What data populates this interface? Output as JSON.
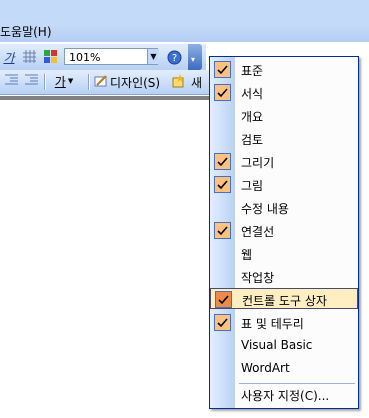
{
  "menubar": {
    "help_label": "도움말(H)"
  },
  "toolbar": {
    "zoom_value": "101%",
    "design_label": "디자인(S)",
    "new_label": "새",
    "font_char": "가",
    "underline_char": "가"
  },
  "popup": {
    "items": [
      {
        "label": "표준",
        "checked": true
      },
      {
        "label": "서식",
        "checked": true
      },
      {
        "label": "개요",
        "checked": false
      },
      {
        "label": "검토",
        "checked": false
      },
      {
        "label": "그리기",
        "checked": true
      },
      {
        "label": "그림",
        "checked": true
      },
      {
        "label": "수정 내용",
        "checked": false
      },
      {
        "label": "연결선",
        "checked": true
      },
      {
        "label": "웹",
        "checked": false
      },
      {
        "label": "작업창",
        "checked": false
      },
      {
        "label": "컨트롤 도구 상자",
        "checked": true,
        "highlighted": true
      },
      {
        "label": "표 및 테두리",
        "checked": true
      },
      {
        "label": "Visual Basic",
        "checked": false
      },
      {
        "label": "WordArt",
        "checked": false
      }
    ],
    "customize_label": "사용자 지정(C)..."
  },
  "colors": {
    "check_bg": "#ffc080",
    "highlight_bg": "#ffeec2",
    "toolbar_bg": "#c3daf9"
  }
}
